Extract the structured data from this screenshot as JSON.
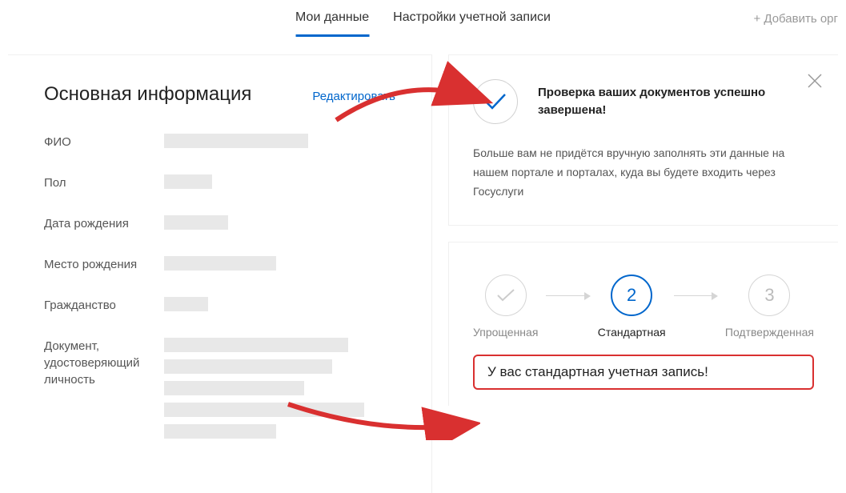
{
  "tabs": {
    "my_data": "Мои данные",
    "account_settings": "Настройки учетной записи",
    "add_org": "+ Добавить орг"
  },
  "main_info": {
    "title": "Основная информация",
    "edit_link": "Редактировать",
    "fields": {
      "fio": "ФИО",
      "gender": "Пол",
      "birth_date": "Дата рождения",
      "birth_place": "Место рождения",
      "citizenship": "Гражданство",
      "identity_doc": "Документ, удостоверяющий личность"
    }
  },
  "notification": {
    "title": "Проверка ваших документов успешно завершена!",
    "body": "Больше вам не придётся вручную заполнять эти данные на нашем портале и порталах, куда вы будете входить через Госуслуги"
  },
  "steps": {
    "step1_label": "Упрощенная",
    "step2_num": "2",
    "step2_label": "Стандартная",
    "step3_num": "3",
    "step3_label": "Подтвержденная"
  },
  "status_message": "У вас стандартная учетная запись!"
}
